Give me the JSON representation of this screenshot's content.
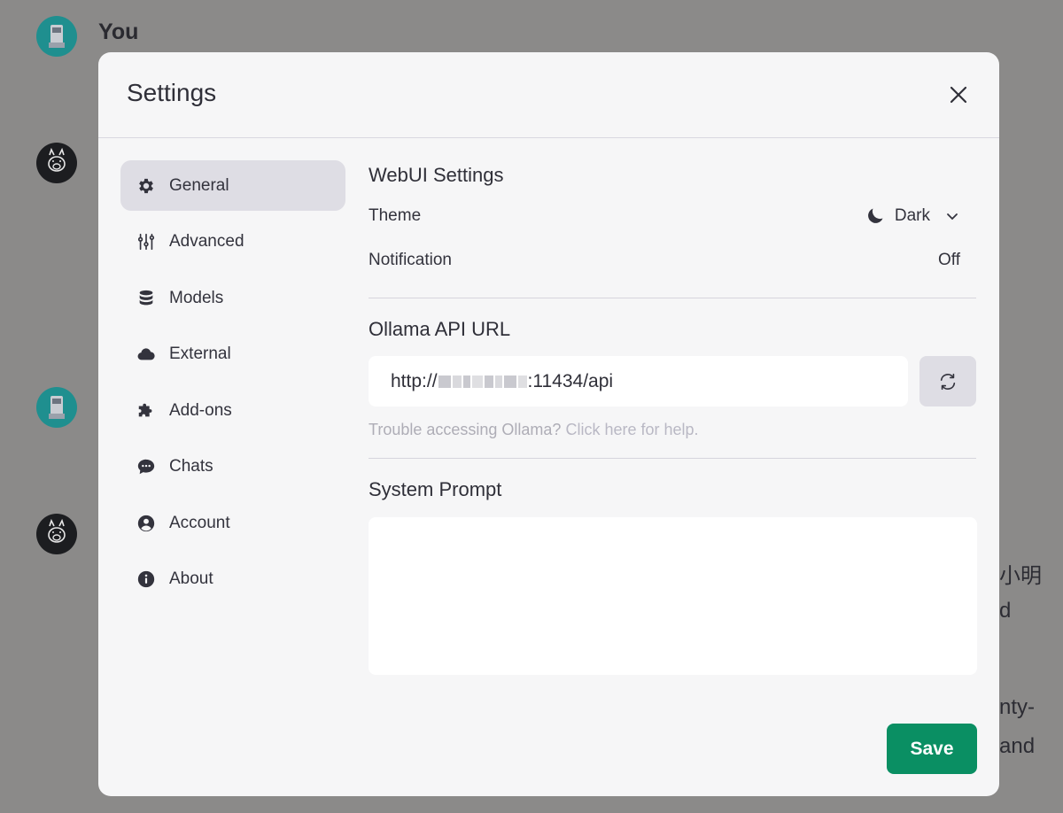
{
  "chat": {
    "user_name": "You",
    "fragments": [
      "小明",
      "d",
      "nty-",
      "and"
    ]
  },
  "settings": {
    "title": "Settings",
    "nav": [
      {
        "label": "General",
        "icon": "gear-icon",
        "active": true
      },
      {
        "label": "Advanced",
        "icon": "sliders-icon",
        "active": false
      },
      {
        "label": "Models",
        "icon": "database-icon",
        "active": false
      },
      {
        "label": "External",
        "icon": "cloud-icon",
        "active": false
      },
      {
        "label": "Add-ons",
        "icon": "puzzle-icon",
        "active": false
      },
      {
        "label": "Chats",
        "icon": "chat-bubble-icon",
        "active": false
      },
      {
        "label": "Account",
        "icon": "user-circle-icon",
        "active": false
      },
      {
        "label": "About",
        "icon": "info-icon",
        "active": false
      }
    ],
    "webui": {
      "title": "WebUI Settings",
      "theme_label": "Theme",
      "theme_value": "Dark",
      "notification_label": "Notification",
      "notification_value": "Off"
    },
    "ollama": {
      "title": "Ollama API URL",
      "url_prefix": "http://",
      "url_suffix": ":11434/api",
      "help_text": "Trouble accessing Ollama?",
      "help_link": "Click here for help."
    },
    "system_prompt": {
      "title": "System Prompt",
      "value": ""
    },
    "save_label": "Save"
  },
  "colors": {
    "accent": "#0a8f63",
    "overlay": "#8b8a89",
    "modal_bg": "#f6f6f7",
    "active_nav": "#dedde4"
  }
}
